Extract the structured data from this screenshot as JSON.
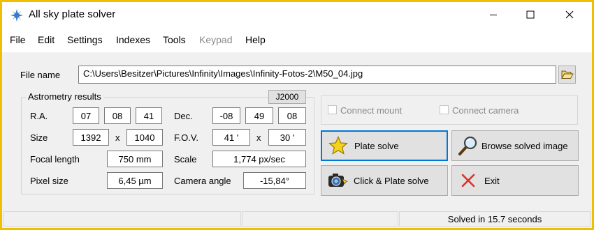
{
  "window": {
    "title": "All sky plate solver"
  },
  "menu": [
    "File",
    "Edit",
    "Settings",
    "Indexes",
    "Tools",
    "Keypad",
    "Help"
  ],
  "file": {
    "label": "File name",
    "path": "C:\\Users\\Besitzer\\Pictures\\Infinity\\Images\\Infinity-Fotos-2\\M50_04.jpg"
  },
  "astrometry": {
    "title": "Astrometry results",
    "epoch_button": "J2000",
    "ra_label": "R.A.",
    "ra": [
      "07",
      "08",
      "41"
    ],
    "dec_label": "Dec.",
    "dec": [
      "-08",
      "49",
      "08"
    ],
    "size_label": "Size",
    "size_w": "1392",
    "size_h": "1040",
    "x_sep": "x",
    "fov_label": "F.O.V.",
    "fov_w": "41 '",
    "fov_h": "30 '",
    "focal_label": "Focal length",
    "focal": "750 mm",
    "scale_label": "Scale",
    "scale": "1,774 px/sec",
    "pixel_label": "Pixel size",
    "pixel": "6,45 µm",
    "angle_label": "Camera angle",
    "angle": "-15,84°"
  },
  "connect": {
    "mount": "Connect mount",
    "camera": "Connect camera"
  },
  "buttons": {
    "plate_solve": "Plate solve",
    "browse_solved": "Browse solved image",
    "click_plate_solve": "Click & Plate solve",
    "exit": "Exit"
  },
  "status": {
    "message": "Solved in 15.7 seconds"
  },
  "colors": {
    "frame": "#f0c000",
    "focus": "#0078d7",
    "star": "#f5d31c",
    "exit_x": "#d9342b"
  },
  "icons": [
    "app-gear-icon",
    "minimize-icon",
    "maximize-icon",
    "close-icon",
    "folder-open-icon",
    "star-icon",
    "magnifier-icon",
    "camera-icon",
    "exit-x-icon"
  ]
}
